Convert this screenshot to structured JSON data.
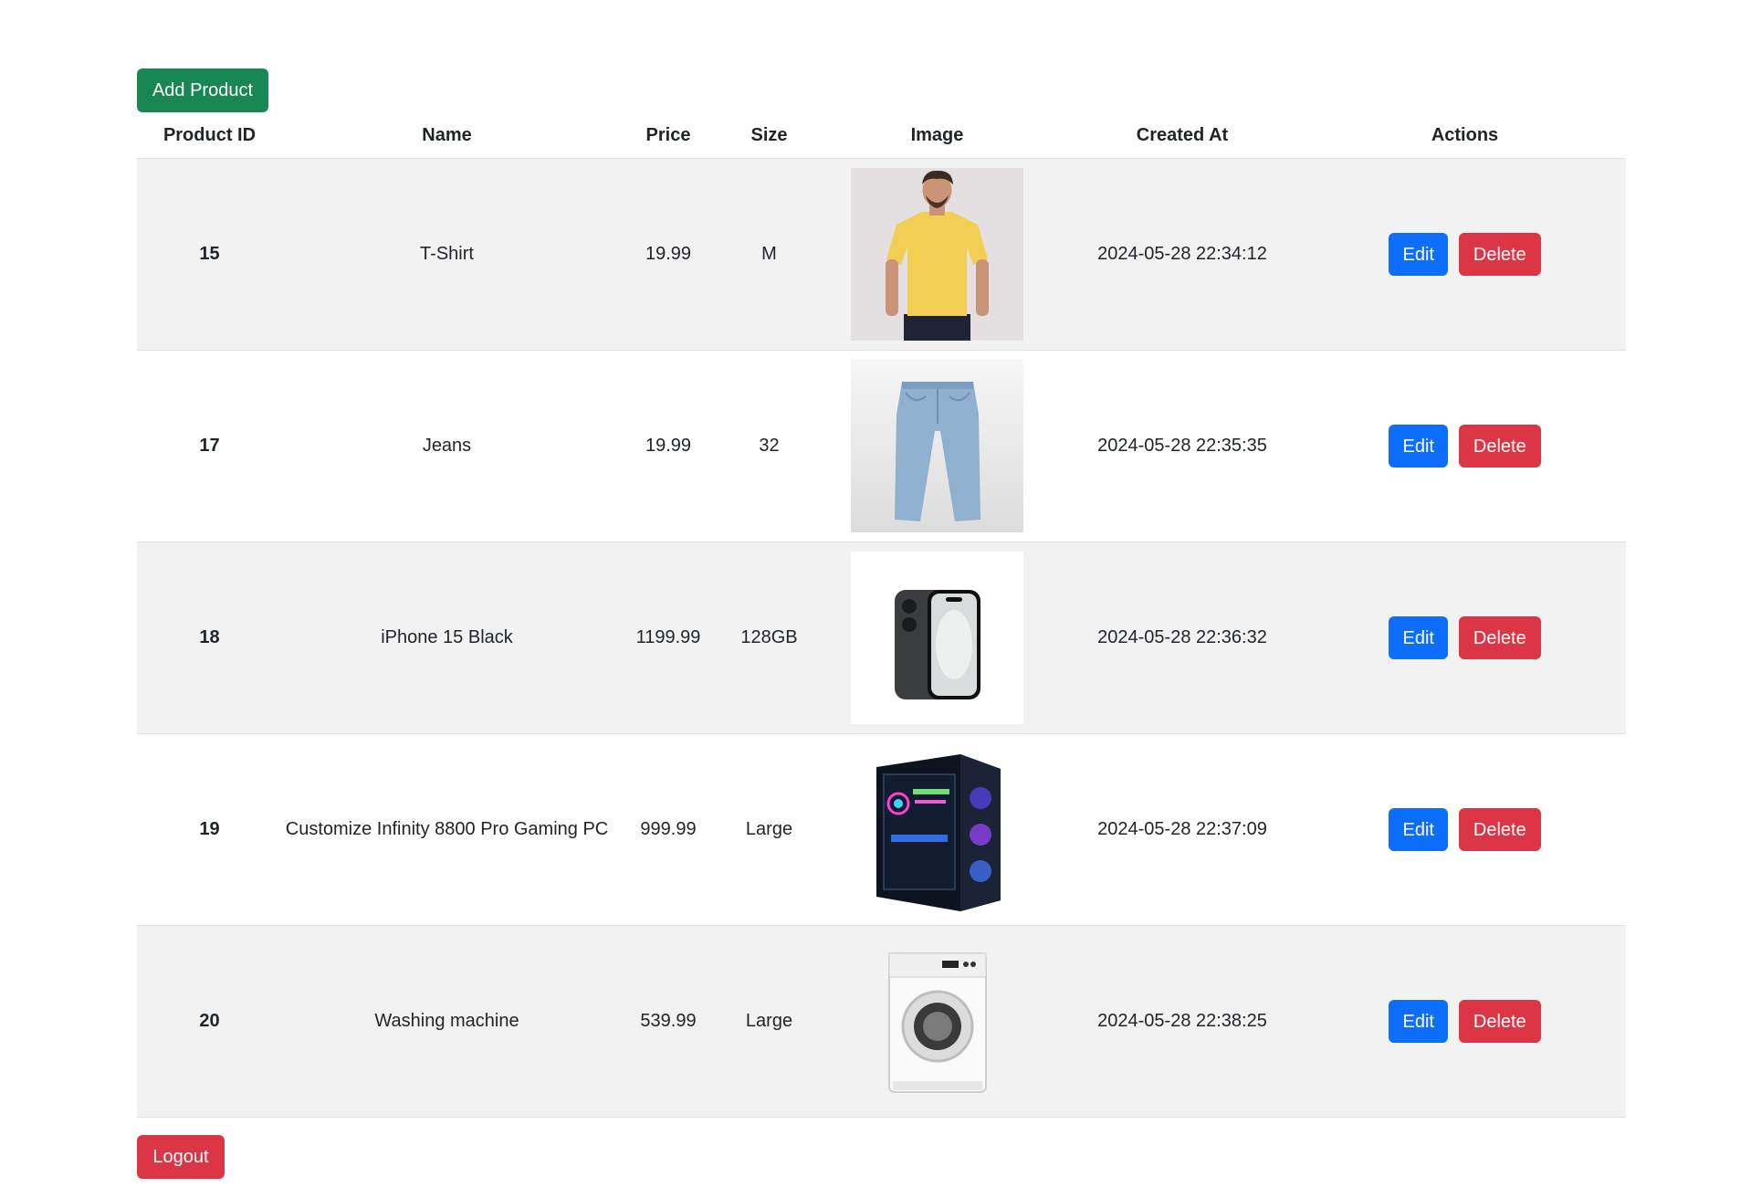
{
  "toolbar": {
    "add_label": "Add Product"
  },
  "table": {
    "headers": [
      "Product ID",
      "Name",
      "Price",
      "Size",
      "Image",
      "Created At",
      "Actions"
    ],
    "rows": [
      {
        "id": "15",
        "name": "T-Shirt",
        "price": "19.99",
        "size": "M",
        "image": "yellow-tshirt-photo",
        "created": "2024-05-28 22:34:12"
      },
      {
        "id": "17",
        "name": "Jeans",
        "price": "19.99",
        "size": "32",
        "image": "jeans-photo",
        "created": "2024-05-28 22:35:35"
      },
      {
        "id": "18",
        "name": "iPhone 15 Black",
        "price": "1199.99",
        "size": "128GB",
        "image": "iphone-photo",
        "created": "2024-05-28 22:36:32"
      },
      {
        "id": "19",
        "name": "Customize Infinity 8800 Pro Gaming PC",
        "price": "999.99",
        "size": "Large",
        "image": "gaming-pc-photo",
        "created": "2024-05-28 22:37:09"
      },
      {
        "id": "20",
        "name": "Washing machine",
        "price": "539.99",
        "size": "Large",
        "image": "washing-machine-photo",
        "created": "2024-05-28 22:38:25"
      }
    ],
    "edit_label": "Edit",
    "delete_label": "Delete"
  },
  "footer": {
    "logout_label": "Logout"
  },
  "colors": {
    "add": "#198754",
    "edit": "#0d6efd",
    "delete": "#dc3545",
    "stripe": "#f2f2f2"
  }
}
